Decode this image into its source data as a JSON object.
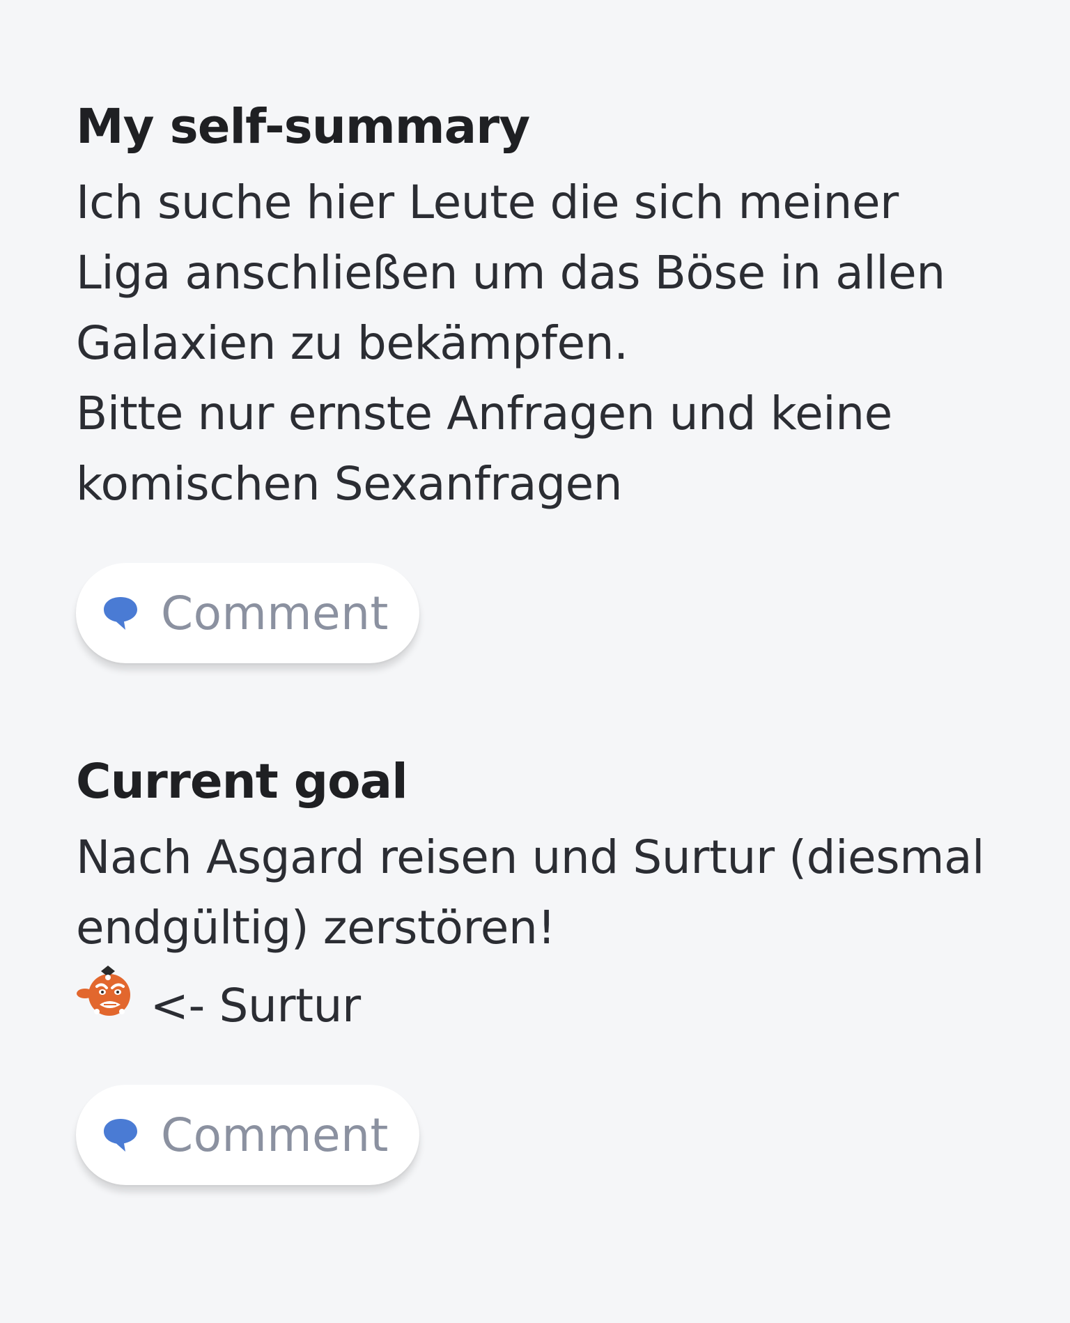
{
  "sections": [
    {
      "title": "My self-summary",
      "lines": [
        "Ich suche hier Leute die sich meiner",
        "Liga anschließen um das Böse in allen",
        "Galaxien zu bekämpfen.",
        "Bitte nur ernste Anfragen und keine",
        "komischen Sexanfragen"
      ],
      "comment_label": "Comment"
    },
    {
      "title": "Current goal",
      "lines": [
        "Nach Asgard reisen und Surtur (diesmal",
        "endgültig) zerstören!"
      ],
      "emoji_line_text": "<- Surtur",
      "emoji_icon": "surtur-emoji-icon",
      "comment_label": "Comment"
    }
  ],
  "colors": {
    "background": "#f5f6f8",
    "accent": "#4a7bd4",
    "muted_text": "#8b91a0"
  }
}
